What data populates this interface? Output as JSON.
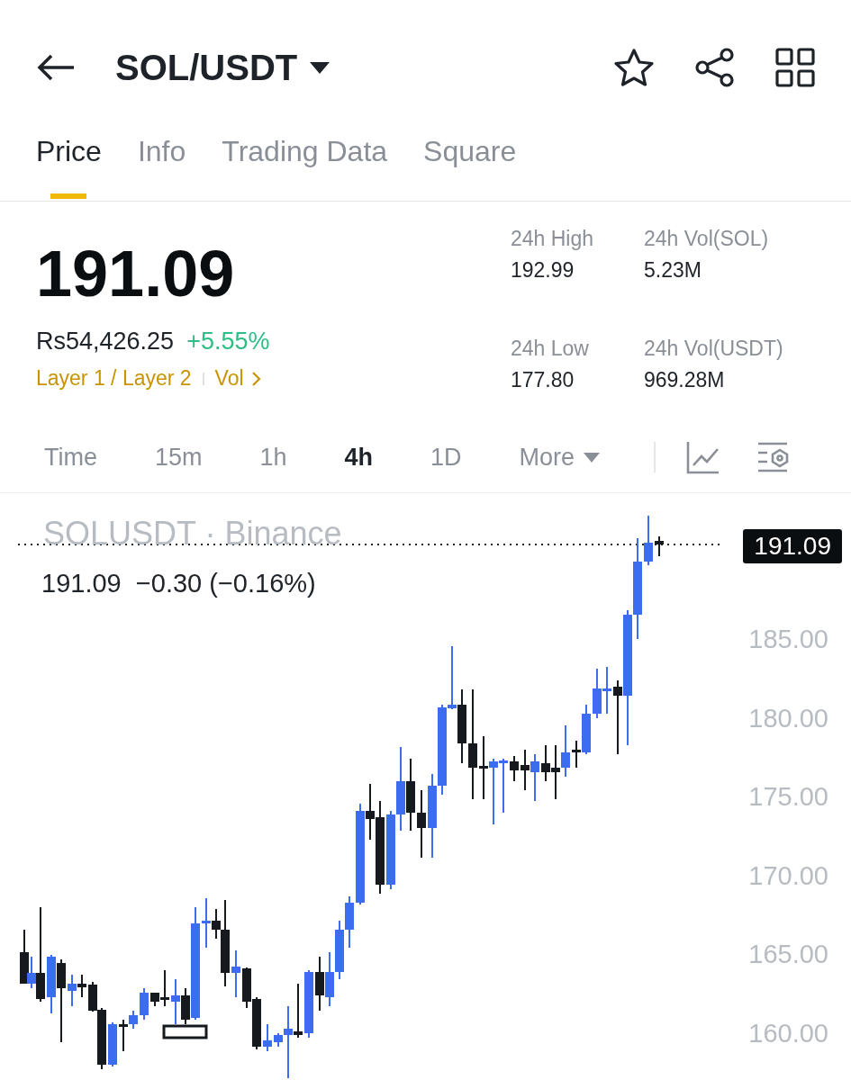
{
  "header": {
    "title": "SOL/USDT"
  },
  "tabs": [
    {
      "label": "Price",
      "selected": true
    },
    {
      "label": "Info",
      "selected": false
    },
    {
      "label": "Trading Data",
      "selected": false
    },
    {
      "label": "Square",
      "selected": false
    }
  ],
  "ticker": {
    "price": "191.09",
    "fiat": "Rs54,426.25",
    "change": "+5.55%",
    "category": "Layer 1 / Layer 2",
    "link": "Vol"
  },
  "stats": [
    {
      "label": "24h High",
      "value": "192.99"
    },
    {
      "label": "24h Vol(SOL)",
      "value": "5.23M"
    },
    {
      "label": "24h Low",
      "value": "177.80"
    },
    {
      "label": "24h Vol(USDT)",
      "value": "969.28M"
    }
  ],
  "intervals": [
    {
      "label": "Time",
      "selected": false
    },
    {
      "label": "15m",
      "selected": false
    },
    {
      "label": "1h",
      "selected": false
    },
    {
      "label": "4h",
      "selected": true
    },
    {
      "label": "1D",
      "selected": false
    },
    {
      "label": "More",
      "selected": false
    }
  ],
  "chart": {
    "title": "SOLUSDT · Binance",
    "legend_price": "191.09",
    "legend_change": "−0.30 (−0.16%)",
    "last_price": "191.09",
    "price_axis": [
      "185.00",
      "180.00",
      "175.00",
      "170.00",
      "165.00",
      "160.00"
    ]
  }
}
